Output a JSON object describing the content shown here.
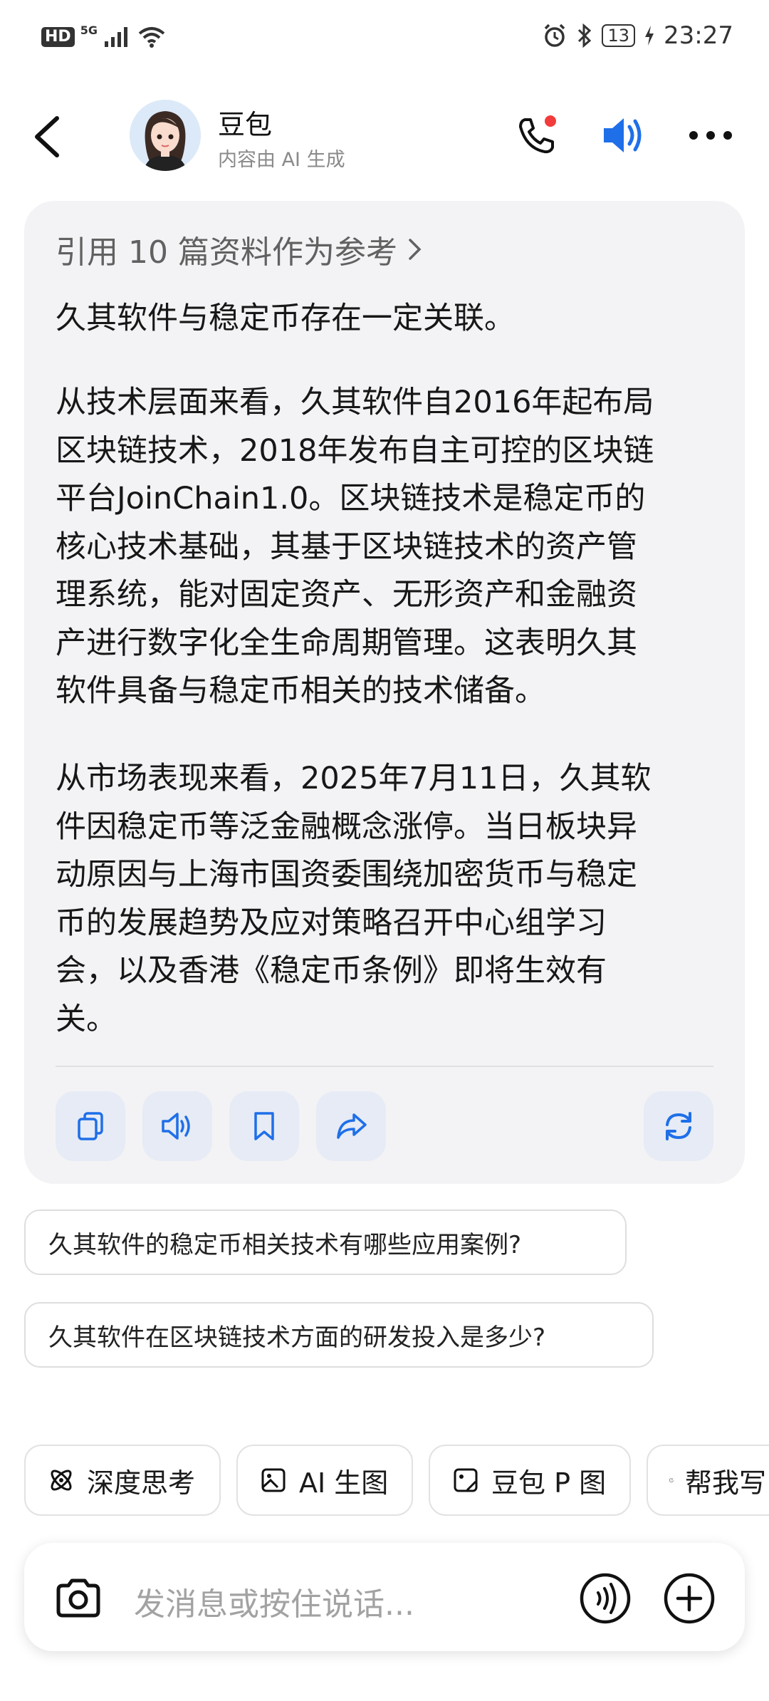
{
  "status_bar": {
    "left": {
      "hd": "HD",
      "network": "5G"
    },
    "right": {
      "battery": "13",
      "time": "23:27"
    }
  },
  "header": {
    "name": "豆包",
    "subtitle": "内容由 AI 生成",
    "icons": [
      "back-icon",
      "phone-icon",
      "speaker-icon",
      "more-icon"
    ],
    "accent_color": "#1f6fe8",
    "notification_dot_color": "#f23b3b"
  },
  "message": {
    "reference": "引用 10 篇资料作为参考",
    "paragraphs": [
      [
        "久其软件与稳定币存在一定关联。"
      ],
      [
        "从技术层面来看，久其软件自2016年起布局",
        "区块链技术，2018年发布自主可控的区块链",
        "平台JoinChain1.0。区块链技术是稳定币的",
        "核心技术基础，其基于区块链技术的资产管",
        "理系统，能对固定资产、无形资产和金融资",
        "产进行数字化全生命周期管理。这表明久其",
        "软件具备与稳定币相关的技术储备。"
      ],
      [
        "从市场表现来看，2025年7月11日，久其软",
        "件因稳定币等泛金融概念涨停。当日板块异",
        "动原因与上海市国资委围绕加密货币与稳定",
        "币的发展趋势及应对策略召开中心组学习",
        "会，以及香港《稳定币条例》即将生效有",
        "关。"
      ]
    ],
    "actions": [
      "copy-icon",
      "read-aloud-icon",
      "bookmark-icon",
      "share-icon",
      "regenerate-icon"
    ]
  },
  "suggestions": [
    "久其软件的稳定币相关技术有哪些应用案例?",
    "久其软件在区块链技术方面的研发投入是多少?"
  ],
  "tools": [
    {
      "label": "深度思考",
      "icon": "deep-think-icon"
    },
    {
      "label": "AI 生图",
      "icon": "image-gen-icon"
    },
    {
      "label": "豆包 P 图",
      "icon": "photo-edit-icon"
    },
    {
      "label": "帮我写",
      "icon": "write-icon"
    }
  ],
  "input": {
    "placeholder": "发消息或按住说话..."
  }
}
